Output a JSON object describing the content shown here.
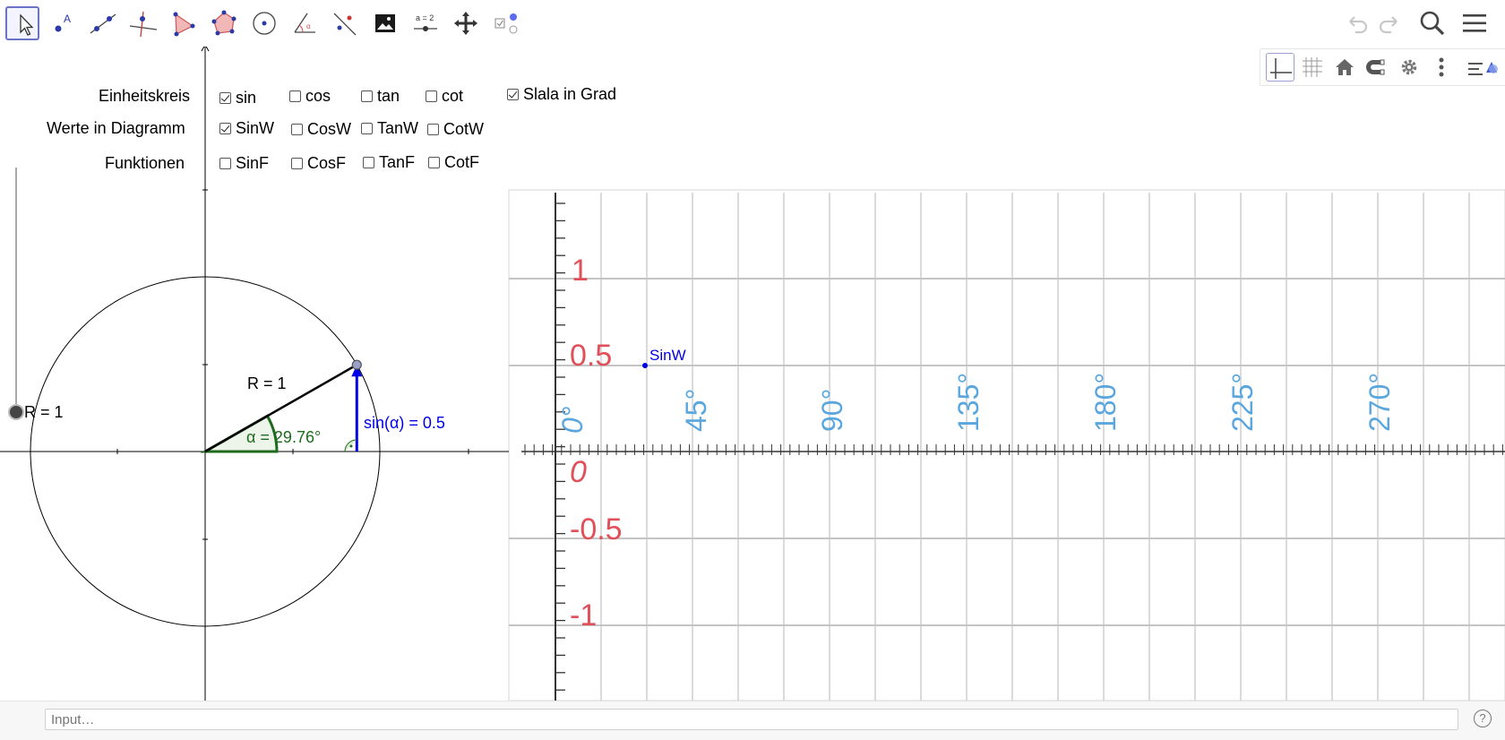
{
  "toolbar": {
    "tools": [
      {
        "name": "move-tool",
        "label": "Move"
      },
      {
        "name": "point-tool",
        "label": "Point",
        "glyph": "A"
      },
      {
        "name": "line-tool",
        "label": "Line"
      },
      {
        "name": "perpendicular-tool",
        "label": "Perpendicular Line"
      },
      {
        "name": "polygon-tool",
        "label": "Polygon"
      },
      {
        "name": "regular-polygon-tool",
        "label": "Regular Polygon"
      },
      {
        "name": "circle-tool",
        "label": "Circle"
      },
      {
        "name": "angle-tool",
        "label": "Angle"
      },
      {
        "name": "reflect-tool",
        "label": "Reflect"
      },
      {
        "name": "image-tool",
        "label": "Image"
      },
      {
        "name": "slider-tool",
        "label": "Slider",
        "glyph": "a = 2"
      },
      {
        "name": "move-view-tool",
        "label": "Move Graphics View"
      },
      {
        "name": "checkbox-tool",
        "label": "Checkbox"
      }
    ]
  },
  "controls": {
    "row_labels": {
      "unit_circle": "Einheitskreis",
      "values_in_diagram": "Werte in Diagramm",
      "functions": "Funktionen"
    },
    "unit_circle": [
      {
        "label": "sin",
        "checked": true
      },
      {
        "label": "cos",
        "checked": false
      },
      {
        "label": "tan",
        "checked": false
      },
      {
        "label": "cot",
        "checked": false
      }
    ],
    "scale_in_degrees": {
      "label": "Slala in Grad",
      "checked": true
    },
    "values_in_diagram": [
      {
        "label": "SinW",
        "checked": true
      },
      {
        "label": "CosW",
        "checked": false
      },
      {
        "label": "TanW",
        "checked": false
      },
      {
        "label": "CotW",
        "checked": false
      }
    ],
    "functions": [
      {
        "label": "SinF",
        "checked": false
      },
      {
        "label": "CosF",
        "checked": false
      },
      {
        "label": "TanF",
        "checked": false
      },
      {
        "label": "CotF",
        "checked": false
      }
    ]
  },
  "construction": {
    "slider_label": "R = 1",
    "radius_label": "R = 1",
    "angle_label": "α = 29.76°",
    "angle_deg": 29.76,
    "sin_label": "sin(α) = 0.5",
    "point_label": "SinW",
    "colors": {
      "angle": "#1e6b1e",
      "sin": "#0000e6",
      "point_fill": "#9aa0c8",
      "axis": "#000"
    }
  },
  "scale_image": {
    "y_ticks": [
      "1",
      "0.5",
      "0",
      "-0.5",
      "-1"
    ],
    "degree_labels": [
      "0°",
      "45°",
      "90°",
      "135°",
      "180°",
      "225°",
      "270°"
    ],
    "colors": {
      "y_labels": "#e0505a",
      "degree_labels": "#5aa6df",
      "grid": "#cfcfcf"
    }
  },
  "input_bar": {
    "placeholder": "Input…",
    "help": "?"
  },
  "view_toolbar": {
    "buttons": [
      "axes-toggle",
      "grid-toggle",
      "standard-view",
      "magnet-snap",
      "settings",
      "more-menu",
      "style-bar-toggle"
    ]
  }
}
